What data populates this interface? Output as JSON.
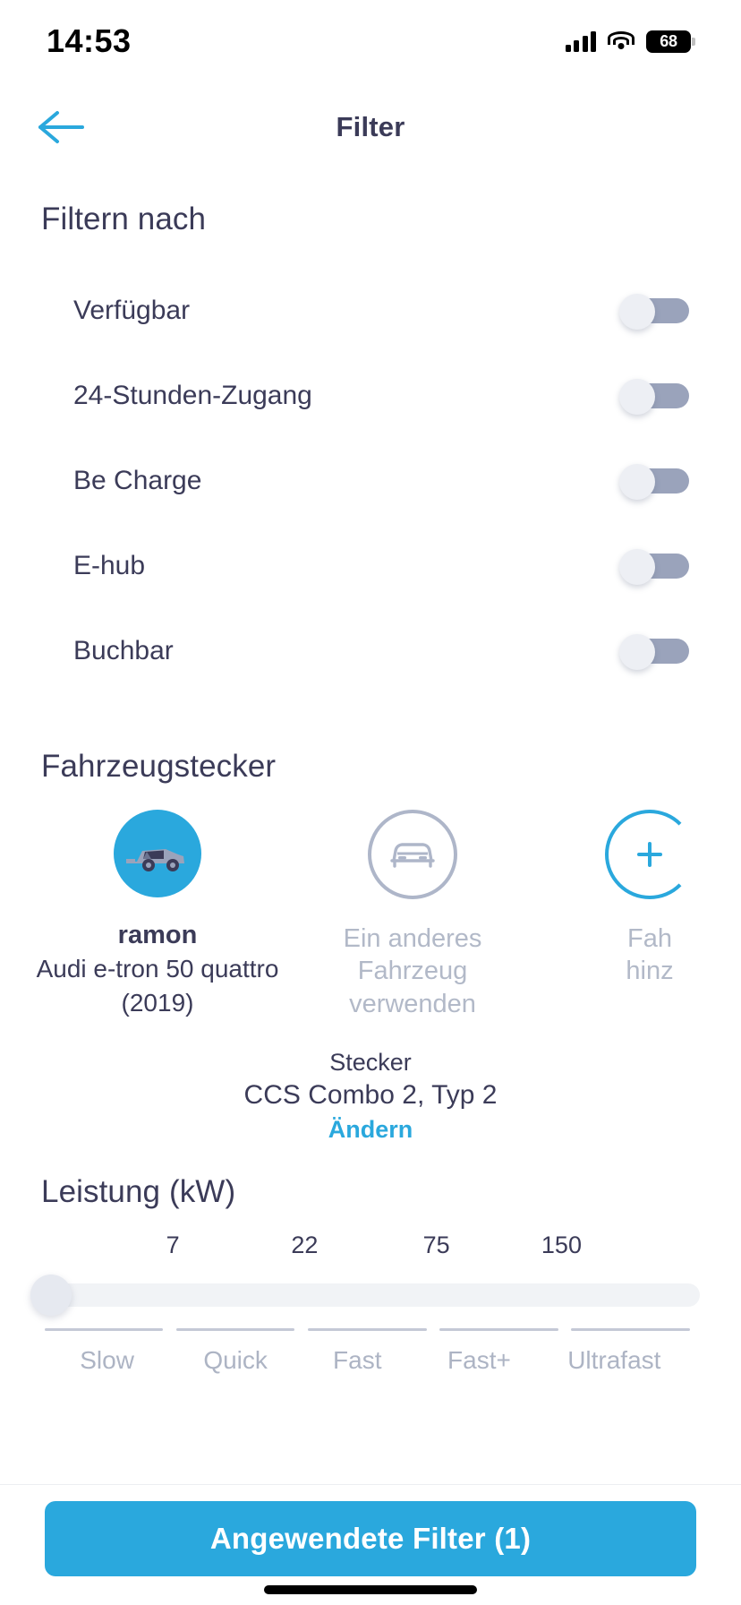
{
  "status_bar": {
    "time": "14:53",
    "battery_level": "68",
    "signal_icon": "cellular-signal-icon",
    "wifi_icon": "wifi-icon",
    "battery_icon": "battery-icon"
  },
  "nav": {
    "back_icon": "back-arrow-icon",
    "title": "Filter"
  },
  "filter_section": {
    "heading": "Filtern nach",
    "toggles": [
      {
        "label": "Verfügbar",
        "on": false
      },
      {
        "label": "24-Stunden-Zugang",
        "on": false
      },
      {
        "label": "Be Charge",
        "on": false
      },
      {
        "label": "E-hub",
        "on": false
      },
      {
        "label": "Buchbar",
        "on": false
      }
    ]
  },
  "vehicle_section": {
    "heading": "Fahrzeugstecker",
    "cards": [
      {
        "icon": "car-avatar-icon",
        "name": "ramon",
        "model": "Audi e-tron 50 quattro",
        "year": "(2019)"
      },
      {
        "icon": "car-outline-icon",
        "label_line1": "Ein anderes",
        "label_line2": "Fahrzeug",
        "label_line3": "verwenden"
      },
      {
        "icon": "plus-circle-icon",
        "label_line1": "Fah",
        "label_line2": "hinz"
      }
    ],
    "plug_caption": "Stecker",
    "plug_value": "CCS Combo 2, Typ 2",
    "change_link": "Ändern"
  },
  "power_section": {
    "heading": "Leistung (kW)",
    "scale_values": [
      "7",
      "22",
      "75",
      "150"
    ],
    "speed_labels": [
      "Slow",
      "Quick",
      "Fast",
      "Fast+",
      "Ultrafast"
    ],
    "knob_position_percent": 0
  },
  "footer": {
    "apply_button": "Angewendete Filter (1)"
  },
  "colors": {
    "accent": "#2aa8dd",
    "text_dark": "#3b3b58",
    "text_muted": "#b2b9c8",
    "toggle_track": "#9aa3bb",
    "toggle_knob": "#edeff4"
  }
}
